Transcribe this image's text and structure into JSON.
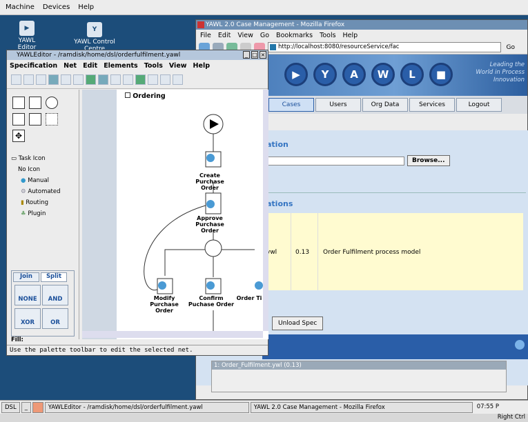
{
  "vbox_menu": {
    "machine": "Machine",
    "devices": "Devices",
    "help": "Help"
  },
  "desktop": {
    "icon1": "YAWL Editor",
    "icon2": "YAWL Control Centre"
  },
  "firefox": {
    "title": "YAWL 2.0 Case Management - Mozilla Firefox",
    "menu": [
      "File",
      "Edit",
      "View",
      "Go",
      "Bookmarks",
      "Tools",
      "Help"
    ],
    "url": "http://localhost:8080/resourceService/fac",
    "go_label": "Go",
    "banner_letters": [
      "Y",
      "A",
      "W",
      "L"
    ],
    "banner_tagline": [
      "Leading the",
      "World in Process",
      "Innovation"
    ],
    "tabs": [
      "Cases",
      "Users",
      "Org Data",
      "Services",
      "Logout"
    ],
    "upload_title": "ation",
    "browse_label": "Browse...",
    "loaded_title": "ations",
    "spec_row": {
      "name": "ywl",
      "version": "0.13",
      "description": "Order Fulfilment process model"
    },
    "unload_label": "Unload Spec",
    "running_case": "1: Order_Fulfilment.ywl (0.13)"
  },
  "editor": {
    "title": "YAWLEditor - /ramdisk/home/dsl/orderfulfilment.yawl",
    "menu": [
      "Specification",
      "Net",
      "Edit",
      "Elements",
      "Tools",
      "View",
      "Help"
    ],
    "tree": {
      "root": "Task Icon",
      "items": [
        "No Icon",
        "Manual",
        "Automated",
        "Routing",
        "Plugin"
      ]
    },
    "join_tab": "Join",
    "split_tab": "Split",
    "js_buttons": [
      "NONE",
      "AND",
      "XOR",
      "OR"
    ],
    "fill_label": "Fill:",
    "net_name": "Ordering",
    "tasks": {
      "create": "Create Purchase Order",
      "approve": "Approve Purchase Order",
      "modify": "Modify Purchase Order",
      "confirm": "Confirm Puchase Order",
      "timeout": "Order Ti"
    },
    "status": "Use the palette toolbar to edit the selected net."
  },
  "taskbar": {
    "dsl": "DSL",
    "editor_task": "YAWLEditor - /ramdisk/home/dsl/orderfulfilment.yawl",
    "firefox_task": "YAWL 2.0 Case Management - Mozilla Firefox",
    "clock": "07:55 P",
    "host_key": "Right Ctrl"
  }
}
